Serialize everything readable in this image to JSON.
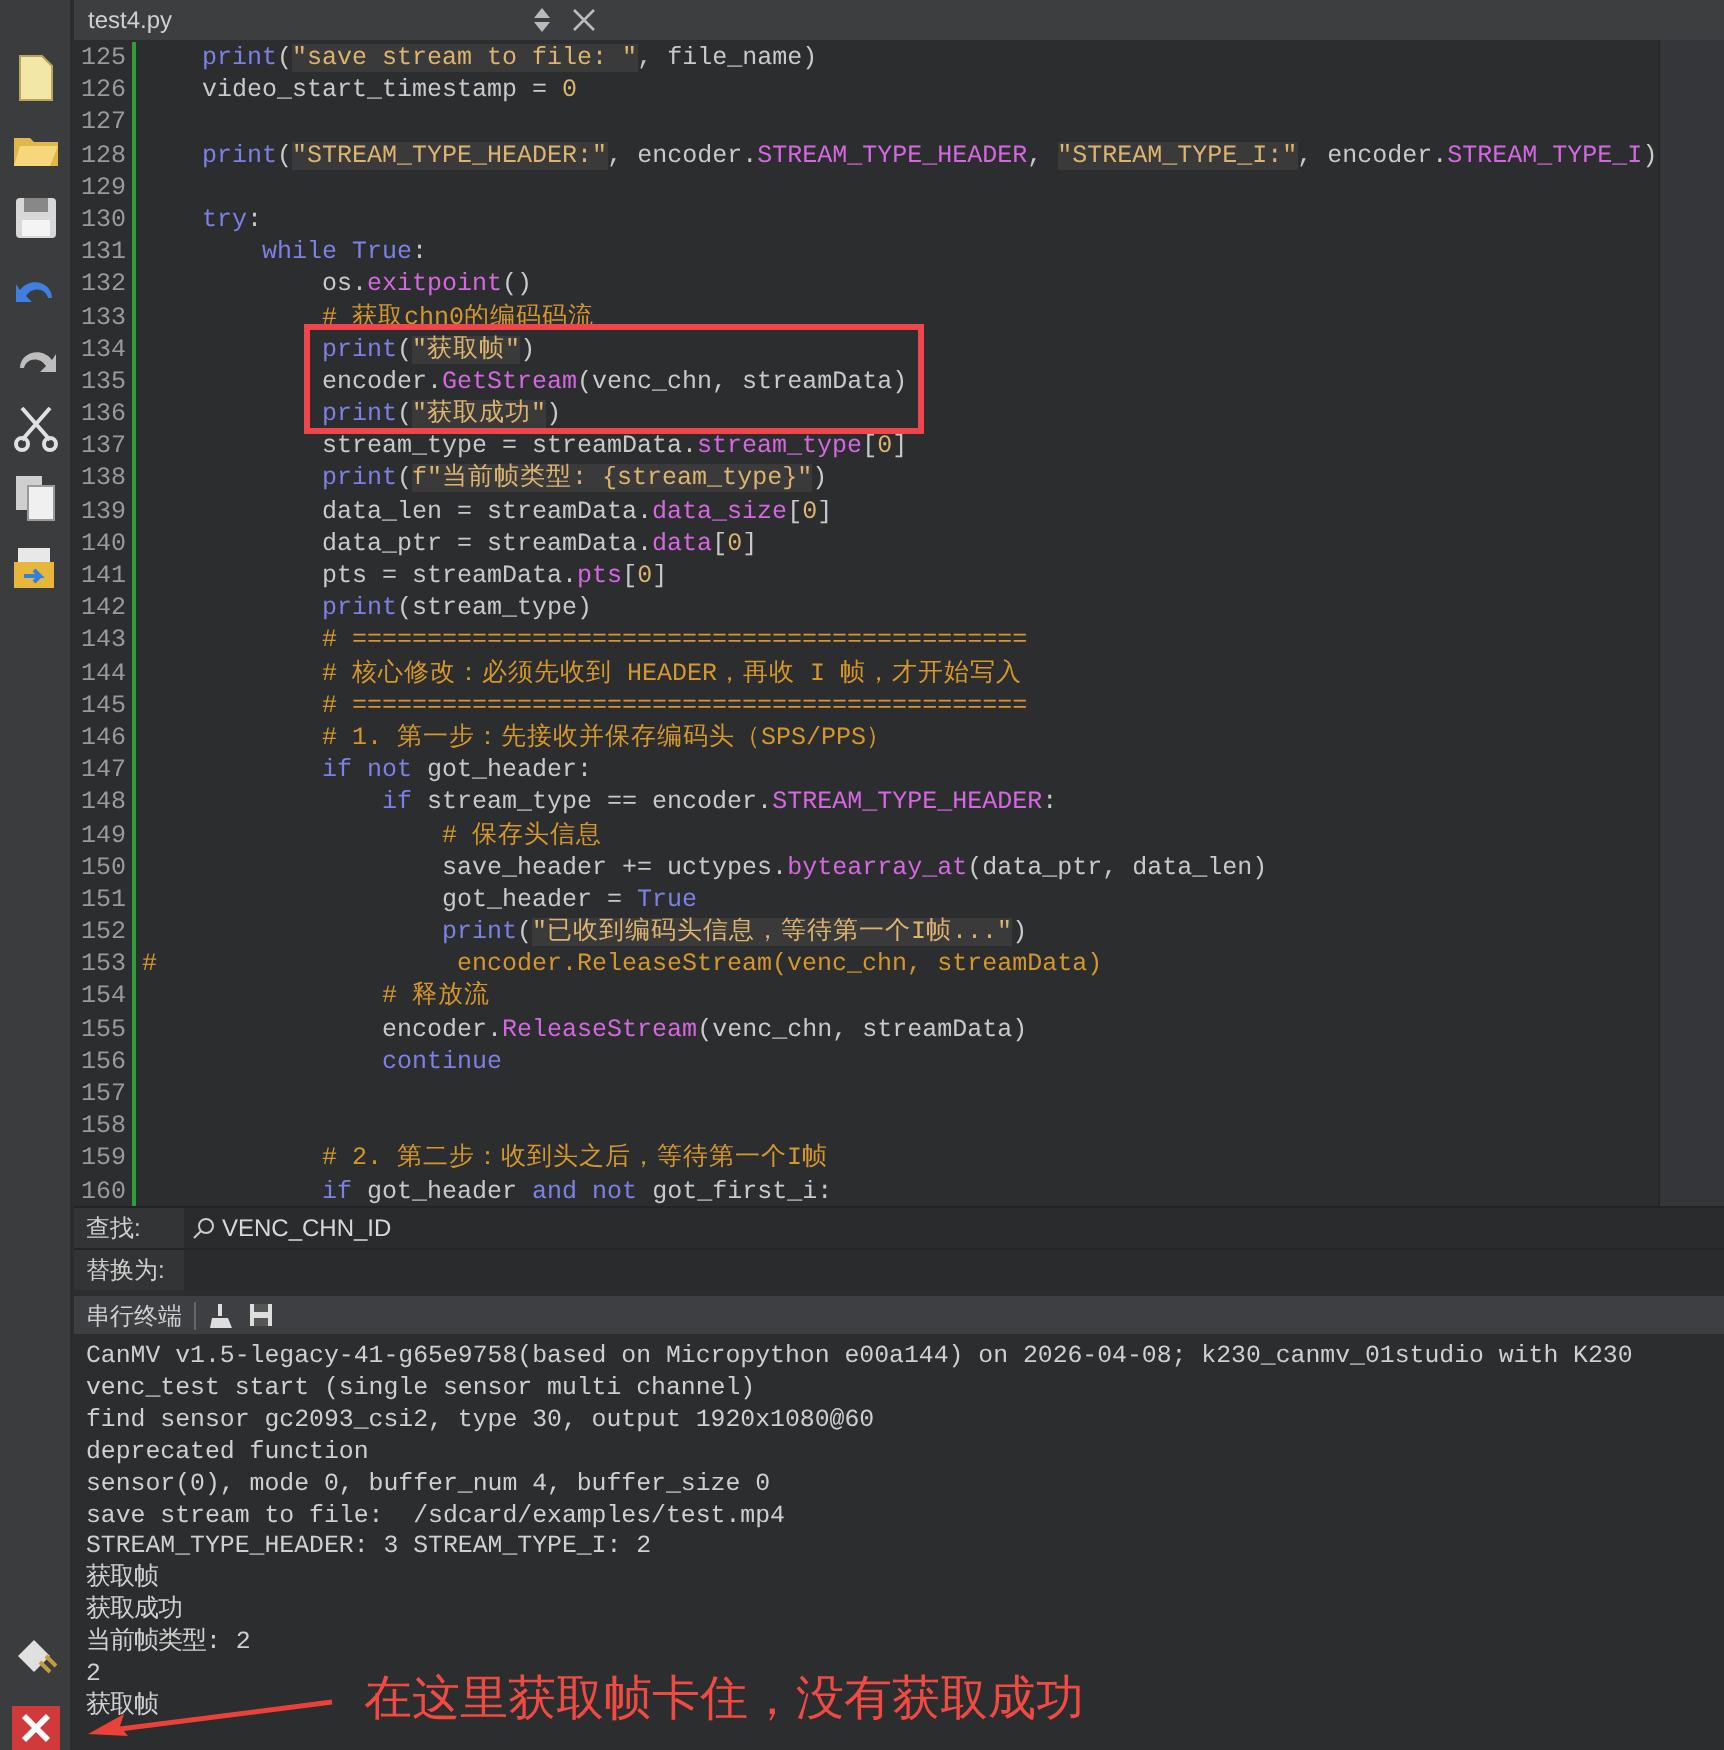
{
  "tab": {
    "title": "test4.py"
  },
  "editor": {
    "lines": [
      {
        "number": "125",
        "segments": [
          {
            "text": "    print",
            "kind": "keyword"
          },
          {
            "text": "(",
            "kind": "plain"
          },
          {
            "text": "\"save stream to file: \"",
            "kind": "string"
          },
          {
            "text": ", file_name)",
            "kind": "plain"
          }
        ]
      },
      {
        "number": "126",
        "segments": [
          {
            "text": "    video_start_timestamp = ",
            "kind": "plain"
          },
          {
            "text": "0",
            "kind": "number"
          }
        ]
      },
      {
        "number": "127"
      },
      {
        "number": "128",
        "segments": [
          {
            "text": "    print",
            "kind": "keyword"
          },
          {
            "text": "(",
            "kind": "plain"
          },
          {
            "text": "\"STREAM_TYPE_HEADER:\"",
            "kind": "string"
          },
          {
            "text": ", encoder.",
            "kind": "plain"
          },
          {
            "text": "STREAM_TYPE_HEADER",
            "kind": "attr"
          },
          {
            "text": ", ",
            "kind": "plain"
          },
          {
            "text": "\"STREAM_TYPE_I:\"",
            "kind": "string"
          },
          {
            "text": ", encoder.",
            "kind": "plain"
          },
          {
            "text": "STREAM_TYPE_I",
            "kind": "attr"
          },
          {
            "text": ")",
            "kind": "plain"
          }
        ]
      },
      {
        "number": "129"
      },
      {
        "number": "130",
        "segments": [
          {
            "text": "    try",
            "kind": "keyword"
          },
          {
            "text": ":",
            "kind": "plain"
          }
        ]
      },
      {
        "number": "131",
        "segments": [
          {
            "text": "        while True",
            "kind": "keyword"
          },
          {
            "text": ":",
            "kind": "plain"
          }
        ]
      },
      {
        "number": "132",
        "segments": [
          {
            "text": "            os.",
            "kind": "plain"
          },
          {
            "text": "exitpoint",
            "kind": "attr"
          },
          {
            "text": "()",
            "kind": "plain"
          }
        ]
      },
      {
        "number": "133",
        "segments": [
          {
            "text": "            # 获取chn0的编码码流",
            "kind": "comment"
          }
        ]
      },
      {
        "number": "134",
        "segments": [
          {
            "text": "            print",
            "kind": "keyword"
          },
          {
            "text": "(",
            "kind": "plain"
          },
          {
            "text": "\"获取帧\"",
            "kind": "string"
          },
          {
            "text": ")",
            "kind": "plain"
          }
        ]
      },
      {
        "number": "135",
        "segments": [
          {
            "text": "            encoder.",
            "kind": "plain"
          },
          {
            "text": "GetStream",
            "kind": "attr"
          },
          {
            "text": "(venc_chn, streamData)",
            "kind": "plain"
          }
        ]
      },
      {
        "number": "136",
        "segments": [
          {
            "text": "            print",
            "kind": "keyword"
          },
          {
            "text": "(",
            "kind": "plain"
          },
          {
            "text": "\"获取成功\"",
            "kind": "string"
          },
          {
            "text": ")",
            "kind": "plain"
          }
        ]
      },
      {
        "number": "137",
        "segments": [
          {
            "text": "            stream_type = streamData.",
            "kind": "plain"
          },
          {
            "text": "stream_type",
            "kind": "attr"
          },
          {
            "text": "[",
            "kind": "plain"
          },
          {
            "text": "0",
            "kind": "number"
          },
          {
            "text": "]",
            "kind": "plain"
          }
        ]
      },
      {
        "number": "138",
        "segments": [
          {
            "text": "            print",
            "kind": "keyword"
          },
          {
            "text": "(",
            "kind": "plain"
          },
          {
            "text": "f\"当前帧类型: {stream_type}\"",
            "kind": "string"
          },
          {
            "text": ")",
            "kind": "plain"
          }
        ]
      },
      {
        "number": "139",
        "segments": [
          {
            "text": "            data_len = streamData.",
            "kind": "plain"
          },
          {
            "text": "data_size",
            "kind": "attr"
          },
          {
            "text": "[",
            "kind": "plain"
          },
          {
            "text": "0",
            "kind": "number"
          },
          {
            "text": "]",
            "kind": "plain"
          }
        ]
      },
      {
        "number": "140",
        "segments": [
          {
            "text": "            data_ptr = streamData.",
            "kind": "plain"
          },
          {
            "text": "data",
            "kind": "attr"
          },
          {
            "text": "[",
            "kind": "plain"
          },
          {
            "text": "0",
            "kind": "number"
          },
          {
            "text": "]",
            "kind": "plain"
          }
        ]
      },
      {
        "number": "141",
        "segments": [
          {
            "text": "            pts = streamData.",
            "kind": "plain"
          },
          {
            "text": "pts",
            "kind": "attr"
          },
          {
            "text": "[",
            "kind": "plain"
          },
          {
            "text": "0",
            "kind": "number"
          },
          {
            "text": "]",
            "kind": "plain"
          }
        ]
      },
      {
        "number": "142",
        "segments": [
          {
            "text": "            print",
            "kind": "keyword"
          },
          {
            "text": "(stream_type)",
            "kind": "plain"
          }
        ]
      },
      {
        "number": "143",
        "segments": [
          {
            "text": "            # =============================================",
            "kind": "comment"
          }
        ]
      },
      {
        "number": "144",
        "segments": [
          {
            "text": "            # 核心修改：必须先收到 HEADER，再收 I 帧，才开始写入",
            "kind": "comment"
          }
        ]
      },
      {
        "number": "145",
        "segments": [
          {
            "text": "            # =============================================",
            "kind": "comment"
          }
        ]
      },
      {
        "number": "146",
        "segments": [
          {
            "text": "            # 1. 第一步：先接收并保存编码头（SPS/PPS）",
            "kind": "comment"
          }
        ]
      },
      {
        "number": "147",
        "segments": [
          {
            "text": "            if not",
            "kind": "keyword"
          },
          {
            "text": " got_header:",
            "kind": "plain"
          }
        ]
      },
      {
        "number": "148",
        "segments": [
          {
            "text": "                if",
            "kind": "keyword"
          },
          {
            "text": " stream_type == encoder.",
            "kind": "plain"
          },
          {
            "text": "STREAM_TYPE_HEADER",
            "kind": "attr"
          },
          {
            "text": ":",
            "kind": "plain"
          }
        ]
      },
      {
        "number": "149",
        "segments": [
          {
            "text": "                    # 保存头信息",
            "kind": "comment"
          }
        ]
      },
      {
        "number": "150",
        "segments": [
          {
            "text": "                    save_header += uctypes.",
            "kind": "plain"
          },
          {
            "text": "bytearray_at",
            "kind": "attr"
          },
          {
            "text": "(data_ptr, data_len)",
            "kind": "plain"
          }
        ]
      },
      {
        "number": "151",
        "segments": [
          {
            "text": "                    got_header = ",
            "kind": "plain"
          },
          {
            "text": "True",
            "kind": "keyword"
          }
        ]
      },
      {
        "number": "152",
        "segments": [
          {
            "text": "                    print",
            "kind": "keyword"
          },
          {
            "text": "(",
            "kind": "plain"
          },
          {
            "text": "\"已收到编码头信息，等待第一个I帧...\"",
            "kind": "string"
          },
          {
            "text": ")",
            "kind": "plain"
          }
        ]
      },
      {
        "number": "153",
        "segments": [
          {
            "text": "#                    encoder.ReleaseStream(venc_chn, streamData)",
            "kind": "comment"
          }
        ]
      },
      {
        "number": "154",
        "segments": [
          {
            "text": "                # 释放流",
            "kind": "comment"
          }
        ]
      },
      {
        "number": "155",
        "segments": [
          {
            "text": "                encoder.",
            "kind": "plain"
          },
          {
            "text": "ReleaseStream",
            "kind": "attr"
          },
          {
            "text": "(venc_chn, streamData)",
            "kind": "plain"
          }
        ]
      },
      {
        "number": "156",
        "segments": [
          {
            "text": "                continue",
            "kind": "keyword"
          }
        ]
      },
      {
        "number": "157"
      },
      {
        "number": "158"
      },
      {
        "number": "159",
        "segments": [
          {
            "text": "            # 2. 第二步：收到头之后，等待第一个I帧",
            "kind": "comment"
          }
        ]
      },
      {
        "number": "160",
        "segments": [
          {
            "text": "            if",
            "kind": "keyword"
          },
          {
            "text": " got_header ",
            "kind": "plain"
          },
          {
            "text": "and not",
            "kind": "keyword"
          },
          {
            "text": " got_first_i:",
            "kind": "plain"
          }
        ]
      }
    ]
  },
  "find_bar": {
    "find_label": "查找:",
    "find_value": "VENC_CHN_ID",
    "replace_label": "替换为:"
  },
  "terminal": {
    "title": "串行终端",
    "lines": [
      "CanMV v1.5-legacy-41-g65e9758(based on Micropython e00a144) on 2026-04-08; k230_canmv_01studio with K230",
      "venc_test start (single sensor multi channel)",
      "find sensor gc2093_csi2, type 30, output 1920x1080@60",
      "deprecated function",
      "sensor(0), mode 0, buffer_num 4, buffer_size 0",
      "save stream to file:  /sdcard/examples/test.mp4",
      "STREAM_TYPE_HEADER: 3 STREAM_TYPE_I: 2",
      "获取帧",
      "获取成功",
      "当前帧类型: 2",
      "2",
      "获取帧"
    ]
  },
  "annotation": {
    "note": "在这里获取帧卡住，没有获取成功"
  }
}
